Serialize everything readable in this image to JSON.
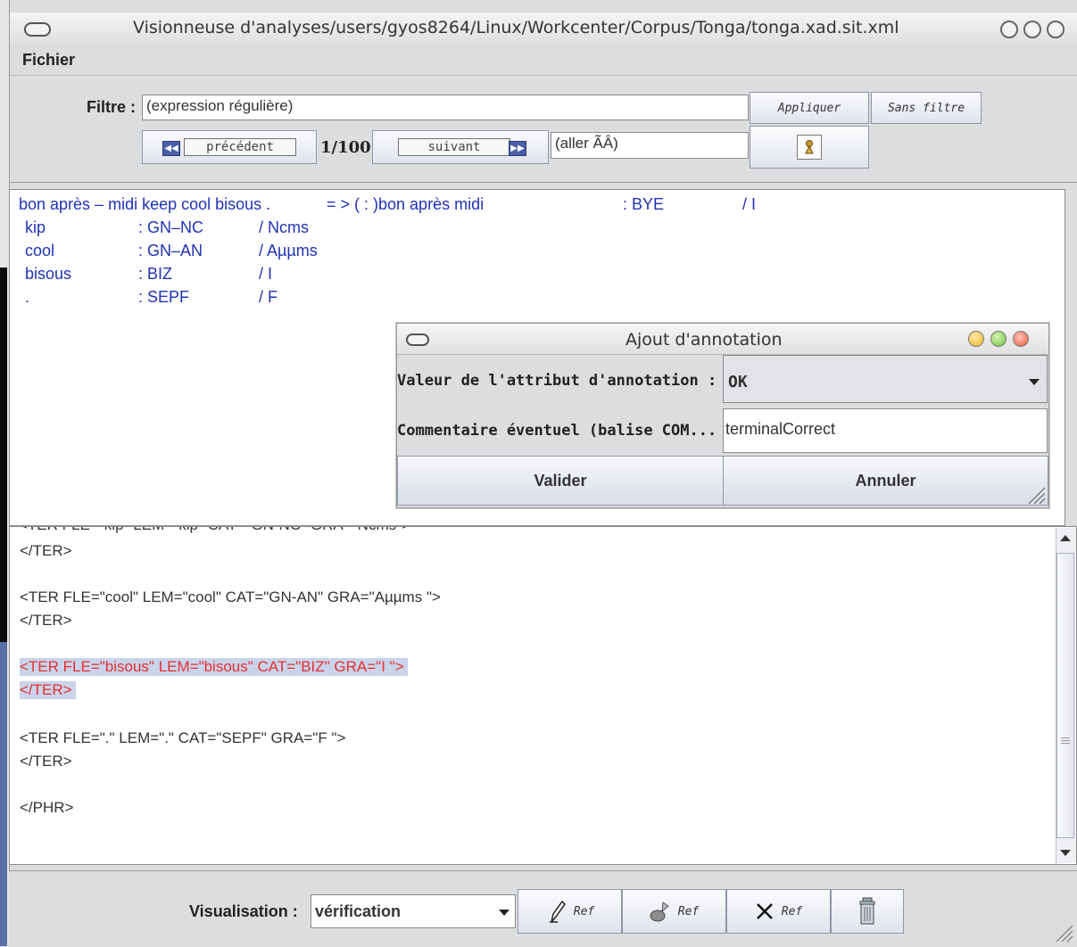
{
  "window": {
    "title": "Visionneuse d'analyses/users/gyos8264/Linux/Workcenter/Corpus/Tonga/tonga.xad.sit.xml"
  },
  "menu": {
    "file": "Fichier"
  },
  "filter": {
    "label": "Filtre :",
    "value": "(expression régulière)",
    "apply": "Appliquer",
    "no_filter": "Sans filtre",
    "prev": "précédent",
    "counter": "1/100",
    "next": "suivant",
    "goto_value": "(aller ÃÂ)"
  },
  "analysis": {
    "header": {
      "sentence": "bon après – midi keep cool bisous .",
      "arrow": "= > (  :  )bon après midi",
      "cat": ": BYE",
      "gra": "/ I"
    },
    "rows": [
      {
        "word": "kip",
        "cat": ": GN–NC",
        "gra": "/ Ncms"
      },
      {
        "word": "cool",
        "cat": ": GN–AN",
        "gra": "/ Aµµms"
      },
      {
        "word": "bisous",
        "cat": ": BIZ",
        "gra": "/ I"
      },
      {
        "word": ".",
        "cat": ": SEPF",
        "gra": "/ F"
      }
    ]
  },
  "xml": {
    "cut_line": "<TER FLE=\"kip\" LEM=\"kip\" CAT=\"GN-NC\" GRA=\"Ncms\">",
    "lines": [
      " </TER>",
      "",
      "<TER FLE=\"cool\" LEM=\"cool\" CAT=\"GN-AN\" GRA=\"Aµµms \">",
      " </TER>",
      "",
      "<TER FLE=\"bisous\" LEM=\"bisous\" CAT=\"BIZ\" GRA=\"I \">",
      " </TER>",
      "",
      "<TER FLE=\".\" LEM=\".\" CAT=\"SEPF\" GRA=\"F \">",
      " </TER>",
      "",
      "</PHR>"
    ]
  },
  "dialog": {
    "title": "Ajout d'annotation",
    "attr_label": "Valeur de l'attribut d'annotation :",
    "attr_value": "OK",
    "comment_label": "Commentaire éventuel (balise COM...",
    "comment_value": "terminalCorrect",
    "validate": "Valider",
    "cancel": "Annuler"
  },
  "bottom": {
    "label": "Visualisation :",
    "mode": "vérification",
    "ref1": "Ref",
    "ref2": "Ref",
    "ref3": "Ref"
  },
  "icons": [
    "window-menu-icon",
    "minimize-icon",
    "maximize-icon",
    "close-icon",
    "first-icon",
    "last-icon",
    "search-icon",
    "pencil-icon",
    "brush-icon",
    "delete-x-icon",
    "trash-icon",
    "resize-grip-icon",
    "dropdown-arrow-icon"
  ],
  "colors": {
    "analysis_text": "#1f33b4",
    "selection_text": "#e53030",
    "selection_bg": "#c9d4ea"
  }
}
